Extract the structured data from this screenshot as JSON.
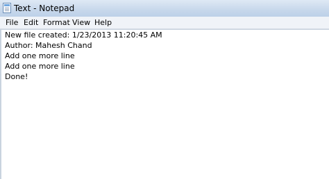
{
  "window": {
    "title": "Text - Notepad",
    "icon": "notepad-icon"
  },
  "menu": {
    "items": [
      {
        "label": "File"
      },
      {
        "label": "Edit"
      },
      {
        "label": "Format"
      },
      {
        "label": "View"
      },
      {
        "label": "Help"
      }
    ]
  },
  "editor": {
    "lines": [
      "New file created: 1/23/2013 11:20:45 AM",
      "Author: Mahesh Chand",
      "Add one more line",
      "Add one more line",
      "Done!"
    ]
  }
}
